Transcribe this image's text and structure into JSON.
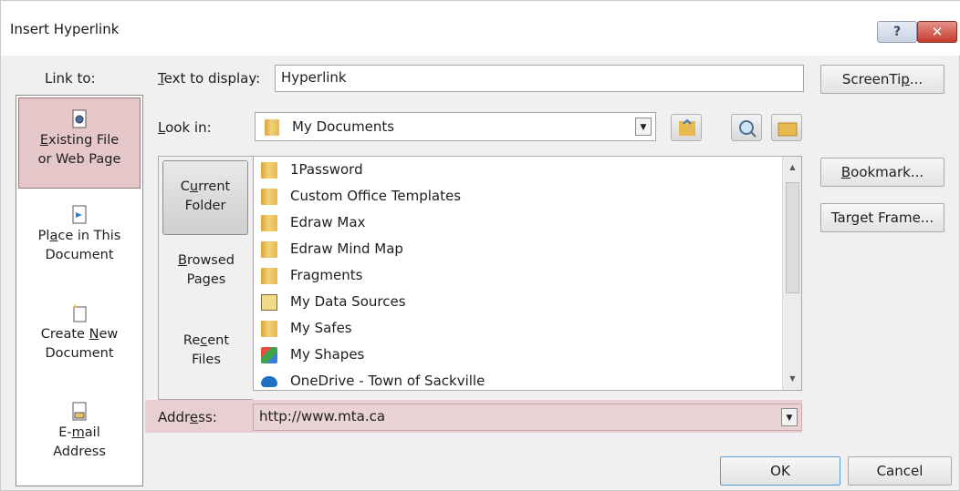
{
  "window": {
    "title": "Insert Hyperlink",
    "help_glyph": "?",
    "close_glyph": "✕"
  },
  "link_to": {
    "label": "Link to:",
    "items": [
      {
        "line1_pre": "",
        "line1_u": "E",
        "line1_post": "xisting File",
        "line2": "or Web Page",
        "icon": "existing-file-icon"
      },
      {
        "line1_pre": "Pl",
        "line1_u": "a",
        "line1_post": "ce in This",
        "line2": "Document",
        "icon": "place-in-document-icon"
      },
      {
        "line1_pre": "Create ",
        "line1_u": "N",
        "line1_post": "ew",
        "line2": "Document",
        "icon": "create-new-document-icon"
      },
      {
        "line1_pre": "E-",
        "line1_u": "m",
        "line1_post": "ail",
        "line2": "Address",
        "icon": "email-address-icon"
      }
    ]
  },
  "text_to_display": {
    "label_u": "T",
    "label_rest": "ext to display:",
    "value": "Hyperlink"
  },
  "screentip": {
    "pre": "ScreenTi",
    "u": "p",
    "post": "..."
  },
  "look_in": {
    "label_u": "L",
    "label_rest": "ook in:",
    "value": "My Documents"
  },
  "nav": [
    {
      "line1_pre": "C",
      "line1_u": "u",
      "line1_post": "rrent",
      "line2": "Folder"
    },
    {
      "line1_pre": "",
      "line1_u": "B",
      "line1_post": "rowsed",
      "line2": "Pages"
    },
    {
      "line1_pre": "Re",
      "line1_u": "c",
      "line1_post": "ent",
      "line2": "Files"
    }
  ],
  "files": [
    {
      "name": "1Password",
      "icon": "folder-icon"
    },
    {
      "name": "Custom Office Templates",
      "icon": "folder-icon"
    },
    {
      "name": "Edraw Max",
      "icon": "folder-icon"
    },
    {
      "name": "Edraw Mind Map",
      "icon": "folder-icon"
    },
    {
      "name": "Fragments",
      "icon": "folder-icon"
    },
    {
      "name": "My Data Sources",
      "icon": "data-sources-icon"
    },
    {
      "name": "My Safes",
      "icon": "folder-icon"
    },
    {
      "name": "My Shapes",
      "icon": "shapes-icon"
    },
    {
      "name": "OneDrive - Town of Sackville",
      "icon": "onedrive-icon"
    }
  ],
  "side_buttons": {
    "bookmark": {
      "pre": "",
      "u": "B",
      "post": "ookmark..."
    },
    "target_frame": {
      "pre": "Tar",
      "u": "g",
      "post": "et Frame..."
    }
  },
  "address": {
    "label_pre": "Addr",
    "label_u": "e",
    "label_post": "ss:",
    "value": "http://www.mta.ca"
  },
  "footer": {
    "ok": "OK",
    "cancel": "Cancel"
  },
  "colors": {
    "selection": "#e5c6c9",
    "address_highlight": "#e8cfd1",
    "ok_border": "#5b9bd5",
    "close_red": "#c43c2f"
  }
}
